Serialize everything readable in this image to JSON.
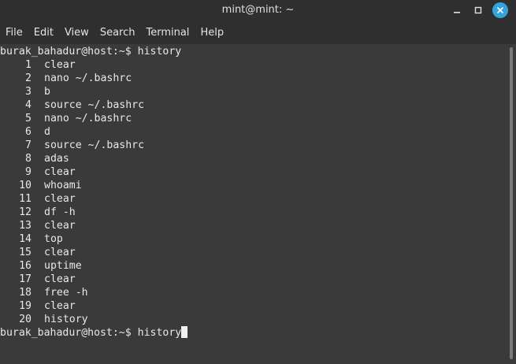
{
  "window": {
    "title": "mint@mint: ~"
  },
  "menu": [
    "File",
    "Edit",
    "View",
    "Search",
    "Terminal",
    "Help"
  ],
  "terminal": {
    "prompt": "burak_bahadur@host:~$ ",
    "command": "history",
    "history": [
      {
        "n": "1",
        "cmd": "clear"
      },
      {
        "n": "2",
        "cmd": "nano ~/.bashrc"
      },
      {
        "n": "3",
        "cmd": "b"
      },
      {
        "n": "4",
        "cmd": "source ~/.bashrc"
      },
      {
        "n": "5",
        "cmd": "nano ~/.bashrc"
      },
      {
        "n": "6",
        "cmd": "d"
      },
      {
        "n": "7",
        "cmd": "source ~/.bashrc"
      },
      {
        "n": "8",
        "cmd": "adas"
      },
      {
        "n": "9",
        "cmd": "clear"
      },
      {
        "n": "10",
        "cmd": "whoami"
      },
      {
        "n": "11",
        "cmd": "clear"
      },
      {
        "n": "12",
        "cmd": "df -h"
      },
      {
        "n": "13",
        "cmd": "clear"
      },
      {
        "n": "14",
        "cmd": "top"
      },
      {
        "n": "15",
        "cmd": "clear"
      },
      {
        "n": "16",
        "cmd": "uptime"
      },
      {
        "n": "17",
        "cmd": "clear"
      },
      {
        "n": "18",
        "cmd": "free -h"
      },
      {
        "n": "19",
        "cmd": "clear"
      },
      {
        "n": "20",
        "cmd": "history"
      }
    ],
    "current_input": "history"
  },
  "icons": {
    "minimize": "minimize-icon",
    "maximize": "maximize-icon",
    "close": "close-icon"
  },
  "colors": {
    "background": "#3a3a3a",
    "chrome": "#2f2f2f",
    "text": "#e8e8e8",
    "close_button": "#35a4dc"
  }
}
